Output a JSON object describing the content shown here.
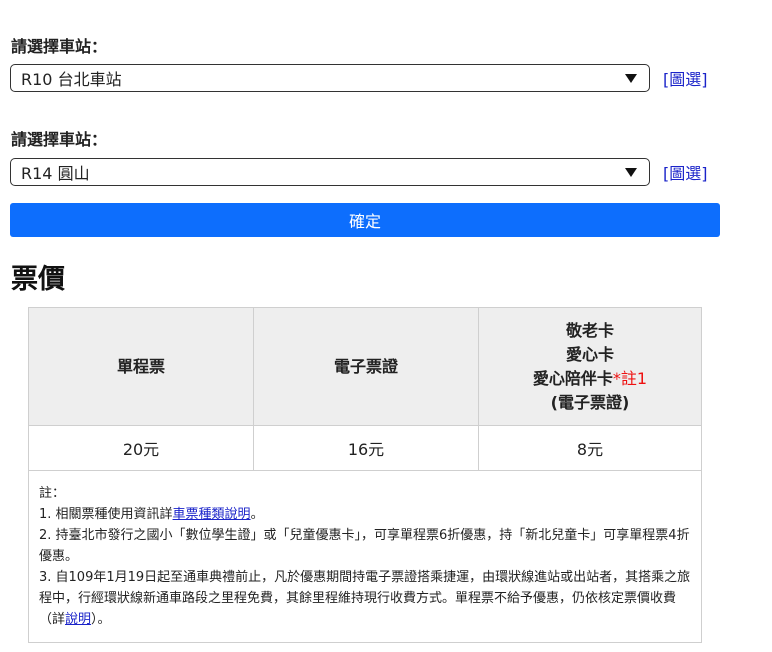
{
  "station_select_1": {
    "label": "請選擇車站：",
    "value": "R10 台北車站",
    "map_link": "[圖選]"
  },
  "station_select_2": {
    "label": "請選擇車站：",
    "value": "R14 圓山",
    "map_link": "[圖選]"
  },
  "confirm_button": "確定",
  "section_title": "票價",
  "fare_table": {
    "headers": {
      "single": "單程票",
      "ecard": "電子票證",
      "concession_line1": "敬老卡",
      "concession_line2": "愛心卡",
      "concession_line3": "愛心陪伴卡",
      "concession_note": "*註1",
      "concession_line4": "(電子票證)"
    },
    "values": {
      "single": "20元",
      "ecard": "16元",
      "concession": "8元"
    }
  },
  "notes": {
    "title": "註：",
    "n1_prefix": "1. 相關票種使用資訊詳",
    "n1_link": "車票種類說明",
    "n1_suffix": "。",
    "n2": "2. 持臺北市發行之國小「數位學生證」或「兒童優惠卡」，可享單程票6折優惠，持「新北兒童卡」可享單程票4折優惠。",
    "n3_prefix": "3. 自109年1月19日起至通車典禮前止，凡於優惠期間持電子票證搭乘捷運，由環狀線進站或出站者，其搭乘之旅程中，行經環狀線新通車路段之里程免費，其餘里程維持現行收費方式。單程票不給予優惠，仍依核定票價收費（詳",
    "n3_link": "說明",
    "n3_suffix": "）。"
  }
}
